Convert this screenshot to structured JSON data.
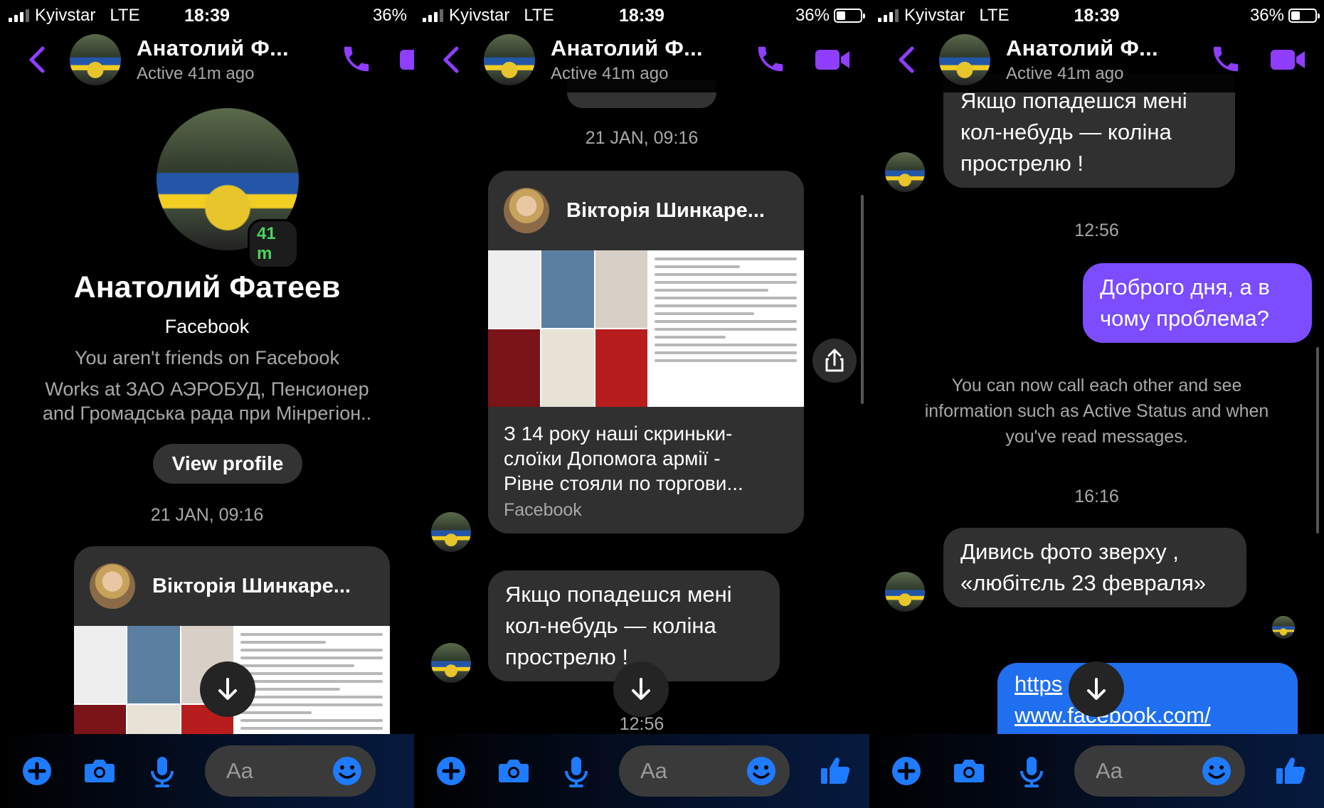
{
  "status": {
    "carrier": "Kyivstar",
    "network": "LTE",
    "time": "18:39",
    "battery": "36%",
    "battery_level": 0.36
  },
  "header": {
    "name": "Анатолий Ф...",
    "active": "Active 41m ago"
  },
  "colors": {
    "accent": "#8f3dff",
    "bubble_mine": "#7b4dff",
    "link": "#1f6ff0",
    "bubble_other": "#303030",
    "online": "#49d45f"
  },
  "icons": [
    "back-icon",
    "phone-icon",
    "video-icon",
    "plus-icon",
    "camera-icon",
    "microphone-icon",
    "smile-icon",
    "like-icon",
    "share-icon",
    "arrow-down-icon"
  ],
  "profile": {
    "name": "Анатолий Фатеев",
    "active_badge": "41 m",
    "platform": "Facebook",
    "friends": "You aren't friends on Facebook",
    "work_line1": "Works at ЗАО АЭРОБУД, Пенсионер",
    "work_line2": "and Громадська рада при Мінрегіон..",
    "view_profile": "View profile"
  },
  "messages": {
    "date_stamp": "21 JAN, 09:16",
    "shared_post": {
      "author": "Вікторія Шинкаре...",
      "text_line1": "З 14 року наші скриньки-",
      "text_line2": "слоїки Допомога армії -",
      "text_line3": "Рівне стояли по торгови...",
      "source": "Facebook"
    },
    "threat": {
      "line1": "Якщо попадешся мені",
      "line2": "кол-небудь — коліна",
      "line3": "прострелю !"
    },
    "time_1256": "12:56",
    "reply": {
      "line1": "Доброго дня, а в",
      "line2": "чому проблема?"
    },
    "info": {
      "line1": "You can now call each other and see",
      "line2": "information such as Active Status and when",
      "line3": "you've read messages."
    },
    "time_1616": "16:16",
    "photo_msg": {
      "line1": "Дивись фото зверху ,",
      "line2": "«любітєль 23 февраля»"
    },
    "link": {
      "line1": "https",
      "line2": "www.facebook.com/"
    }
  },
  "composer": {
    "placeholder": "Aa"
  }
}
